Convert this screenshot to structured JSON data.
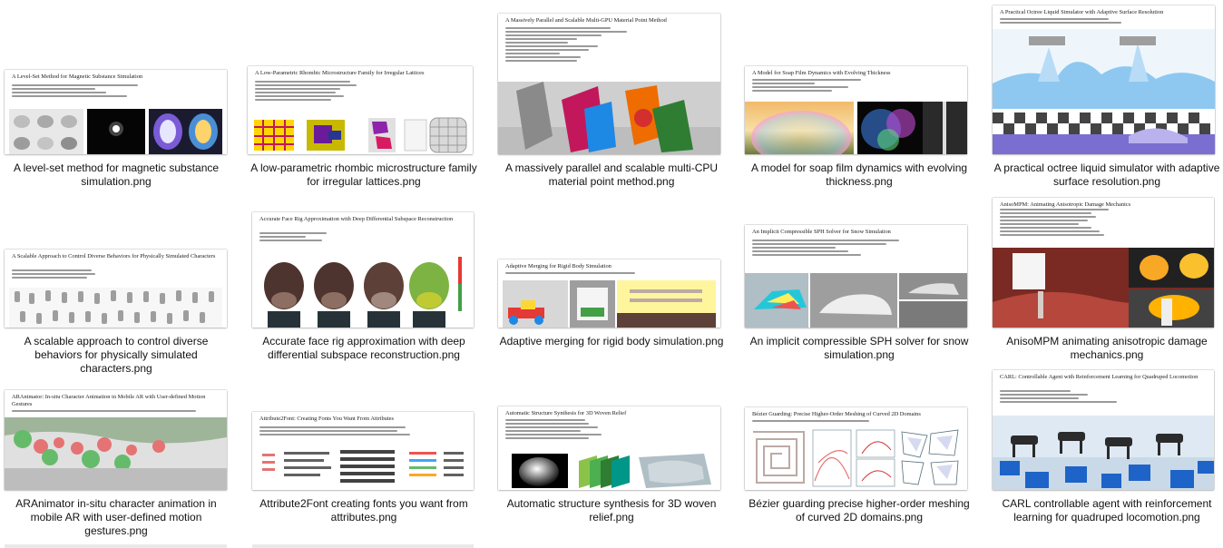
{
  "files": [
    {
      "title": "A Level-Set Method for Magnetic Substance Simulation",
      "label": "A level-set method for magnetic substance simulation.png"
    },
    {
      "title": "A Low-Parametric Rhombic Microstructure Family for Irregular Lattices",
      "label": "A low-parametric rhombic microstructure family for irregular lattices.png"
    },
    {
      "title": "A Massively Parallel and Scalable Multi-GPU Material Point Method",
      "label": "A massively parallel and scalable multi-CPU material point method.png"
    },
    {
      "title": "A Model for Soap Film Dynamics with Evolving Thickness",
      "label": "A model for soap film dynamics with evolving thickness.png"
    },
    {
      "title": "A Practical Octree Liquid Simulator with Adaptive Surface Resolution",
      "label": "A practical octree liquid simulator with adaptive surface resolution.png"
    },
    {
      "title": "A Scalable Approach to Control Diverse Behaviors for Physically Simulated Characters",
      "label": "A scalable approach to control diverse behaviors for physically simulated characters.png"
    },
    {
      "title": "Accurate Face Rig Approximation with Deep Differential Subspace Reconstruction",
      "label": "Accurate face rig approximation with deep differential subspace reconstruction.png"
    },
    {
      "title": "Adaptive Merging for Rigid Body Simulation",
      "label": "Adaptive merging for rigid body simulation.png"
    },
    {
      "title": "An Implicit Compressible SPH Solver for Snow Simulation",
      "label": "An implicit compressible SPH solver for snow simulation.png"
    },
    {
      "title": "AnisoMPM: Animating Anisotropic Damage Mechanics",
      "label": "AnisoMPM animating anisotropic damage mechanics.png"
    },
    {
      "title": "ARAnimator: In-situ Character Animation in Mobile AR with User-defined Motion Gestures",
      "label": "ARAnimator in-situ character animation in mobile AR with user-defined motion gestures.png"
    },
    {
      "title": "Attribute2Font: Creating Fonts You Want From Attributes",
      "label": "Attribute2Font creating fonts you want from attributes.png"
    },
    {
      "title": "Automatic Structure Synthesis for 3D Woven Relief",
      "label": "Automatic structure synthesis for 3D woven relief.png"
    },
    {
      "title": "Bézier Guarding: Precise Higher-Order Meshing of Curved 2D Domains",
      "label": "Bézier guarding precise higher-order meshing of curved 2D domains.png"
    },
    {
      "title": "CARL: Controllable Agent with Reinforcement Learning for Quadruped Locomotion",
      "label": "CARL controllable agent with reinforcement learning for quadruped locomotion.png"
    }
  ]
}
